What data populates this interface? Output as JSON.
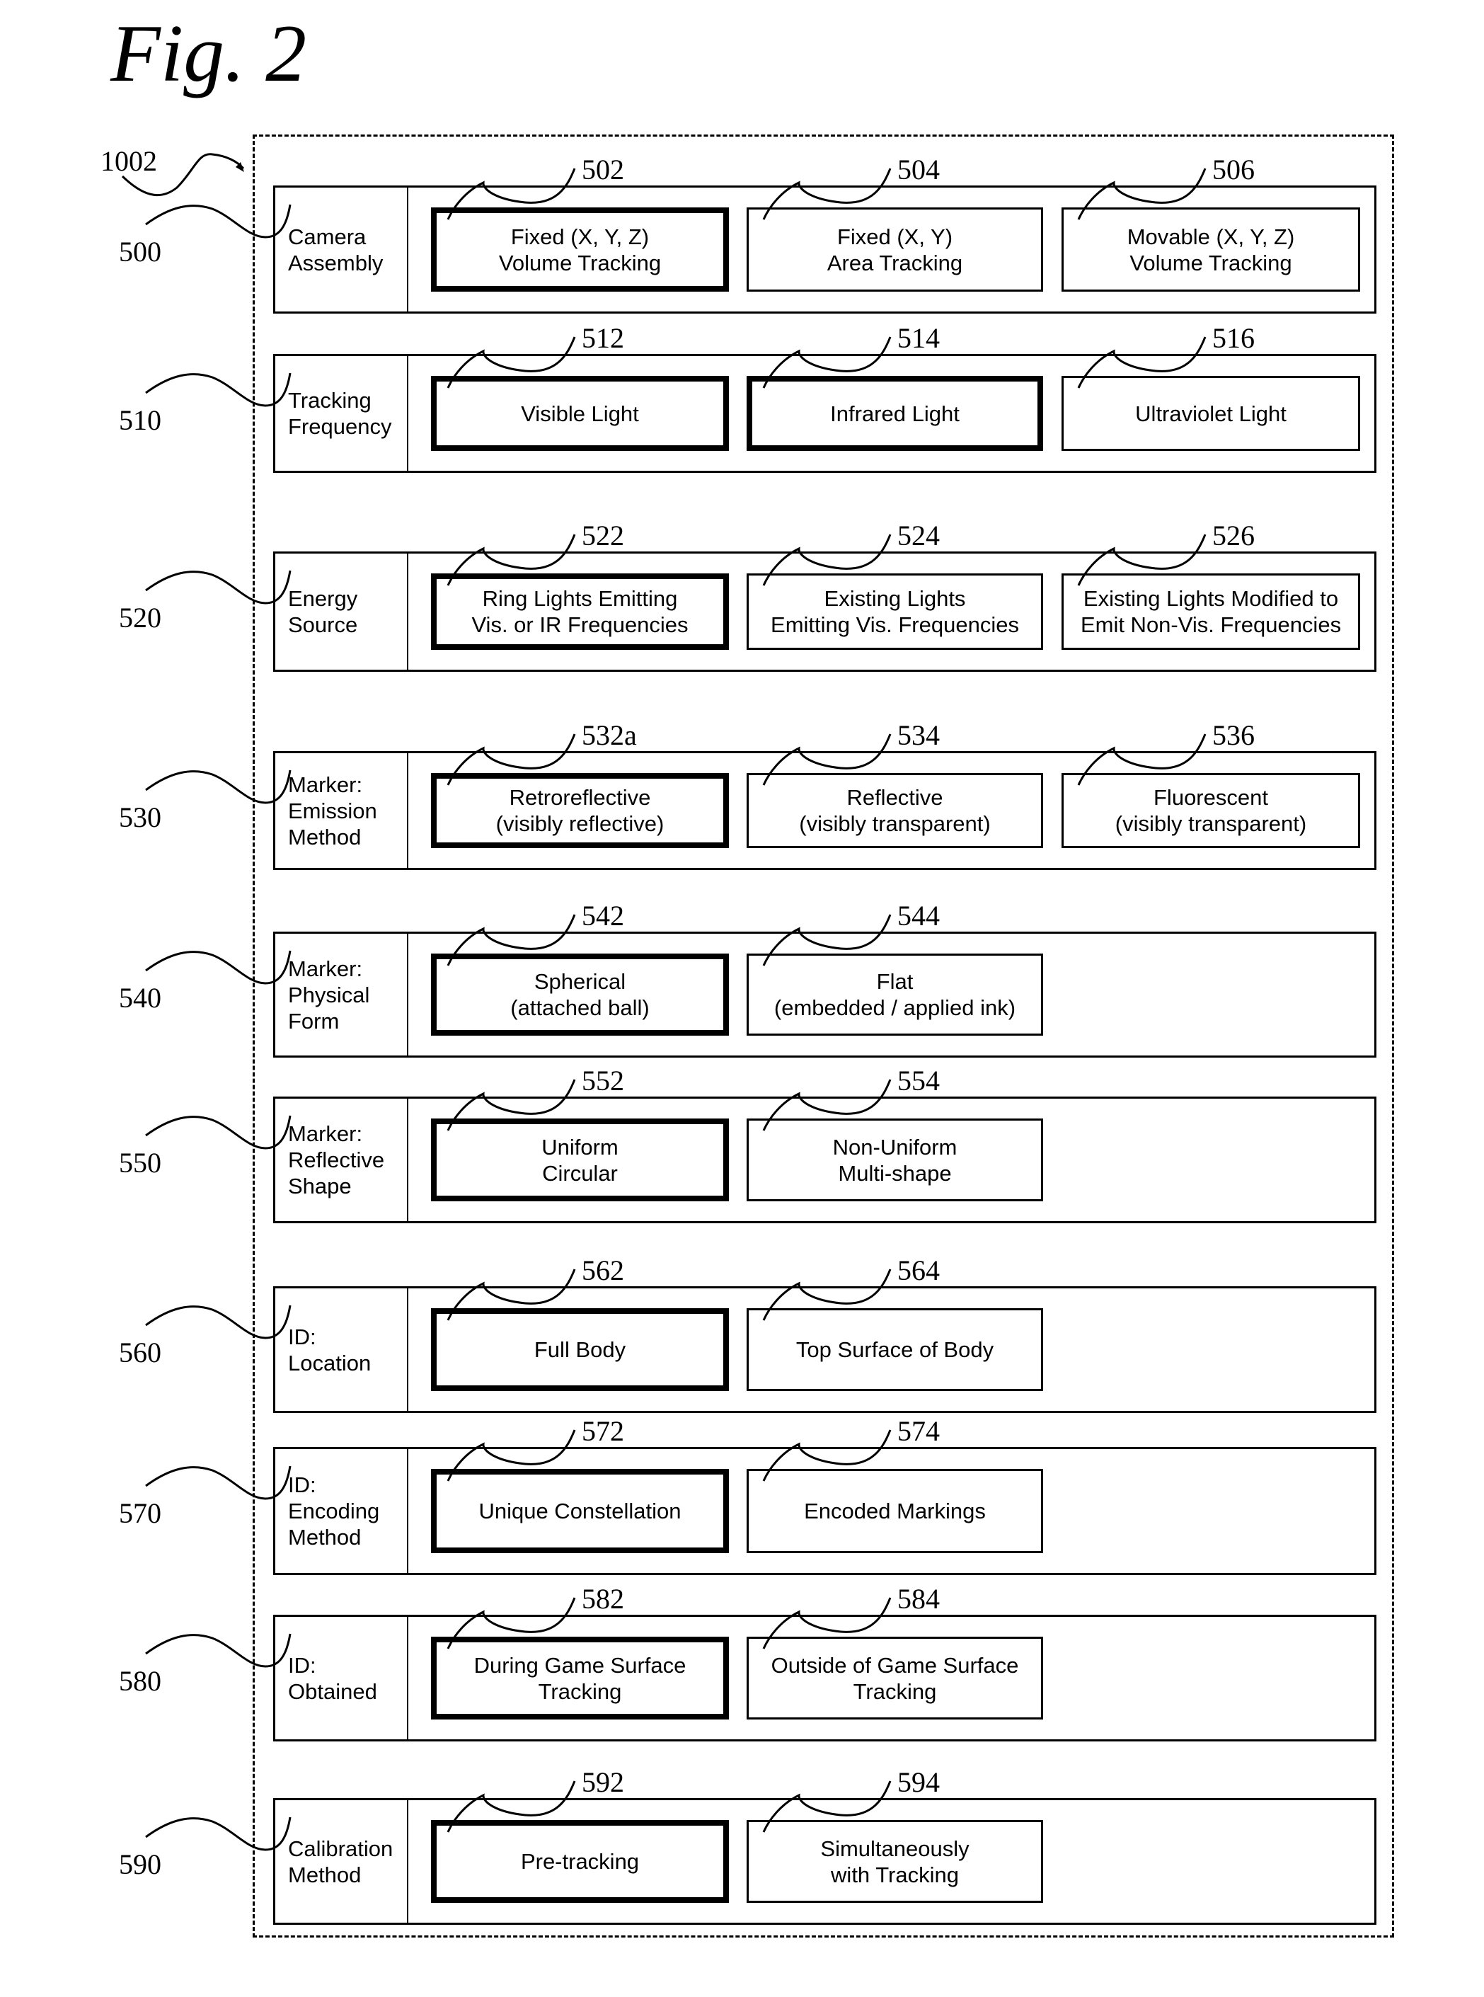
{
  "figure": {
    "title": "Fig. 2",
    "container_ref": "1002"
  },
  "rows": [
    {
      "ref": "500",
      "label": "Camera\nAssembly",
      "options": [
        {
          "ref": "502",
          "text": "Fixed (X, Y, Z)\nVolume Tracking",
          "selected": true
        },
        {
          "ref": "504",
          "text": "Fixed (X, Y)\nArea Tracking",
          "selected": false
        },
        {
          "ref": "506",
          "text": "Movable (X, Y, Z)\nVolume Tracking",
          "selected": false
        }
      ]
    },
    {
      "ref": "510",
      "label": "Tracking\nFrequency",
      "options": [
        {
          "ref": "512",
          "text": "Visible Light",
          "selected": true
        },
        {
          "ref": "514",
          "text": "Infrared Light",
          "selected": true
        },
        {
          "ref": "516",
          "text": "Ultraviolet Light",
          "selected": false
        }
      ]
    },
    {
      "ref": "520",
      "label": "Energy\nSource",
      "options": [
        {
          "ref": "522",
          "text": "Ring Lights Emitting\nVis. or IR Frequencies",
          "selected": true
        },
        {
          "ref": "524",
          "text": "Existing Lights\nEmitting Vis. Frequencies",
          "selected": false
        },
        {
          "ref": "526",
          "text": "Existing Lights Modified to\nEmit Non-Vis. Frequencies",
          "selected": false
        }
      ]
    },
    {
      "ref": "530",
      "label": "Marker:\nEmission\nMethod",
      "options": [
        {
          "ref": "532a",
          "text": "Retroreflective\n(visibly reflective)",
          "selected": true
        },
        {
          "ref": "534",
          "text": "Reflective\n(visibly transparent)",
          "selected": false
        },
        {
          "ref": "536",
          "text": "Fluorescent\n(visibly transparent)",
          "selected": false
        }
      ]
    },
    {
      "ref": "540",
      "label": "Marker:\nPhysical\nForm",
      "options": [
        {
          "ref": "542",
          "text": "Spherical\n(attached ball)",
          "selected": true
        },
        {
          "ref": "544",
          "text": "Flat\n(embedded / applied ink)",
          "selected": false
        }
      ]
    },
    {
      "ref": "550",
      "label": "Marker:\nReflective\nShape",
      "options": [
        {
          "ref": "552",
          "text": "Uniform\nCircular",
          "selected": true
        },
        {
          "ref": "554",
          "text": "Non-Uniform\nMulti-shape",
          "selected": false
        }
      ]
    },
    {
      "ref": "560",
      "label": "ID:\nLocation",
      "options": [
        {
          "ref": "562",
          "text": "Full Body",
          "selected": true
        },
        {
          "ref": "564",
          "text": "Top Surface of Body",
          "selected": false
        }
      ]
    },
    {
      "ref": "570",
      "label": "ID:\nEncoding\nMethod",
      "options": [
        {
          "ref": "572",
          "text": "Unique Constellation",
          "selected": true
        },
        {
          "ref": "574",
          "text": "Encoded Markings",
          "selected": false
        }
      ]
    },
    {
      "ref": "580",
      "label": "ID:\nObtained",
      "options": [
        {
          "ref": "582",
          "text": "During Game Surface\nTracking",
          "selected": true
        },
        {
          "ref": "584",
          "text": "Outside of Game Surface\nTracking",
          "selected": false
        }
      ]
    },
    {
      "ref": "590",
      "label": "Calibration\nMethod",
      "options": [
        {
          "ref": "592",
          "text": "Pre-tracking",
          "selected": true
        },
        {
          "ref": "594",
          "text": "Simultaneously\nwith Tracking",
          "selected": false
        }
      ]
    }
  ]
}
